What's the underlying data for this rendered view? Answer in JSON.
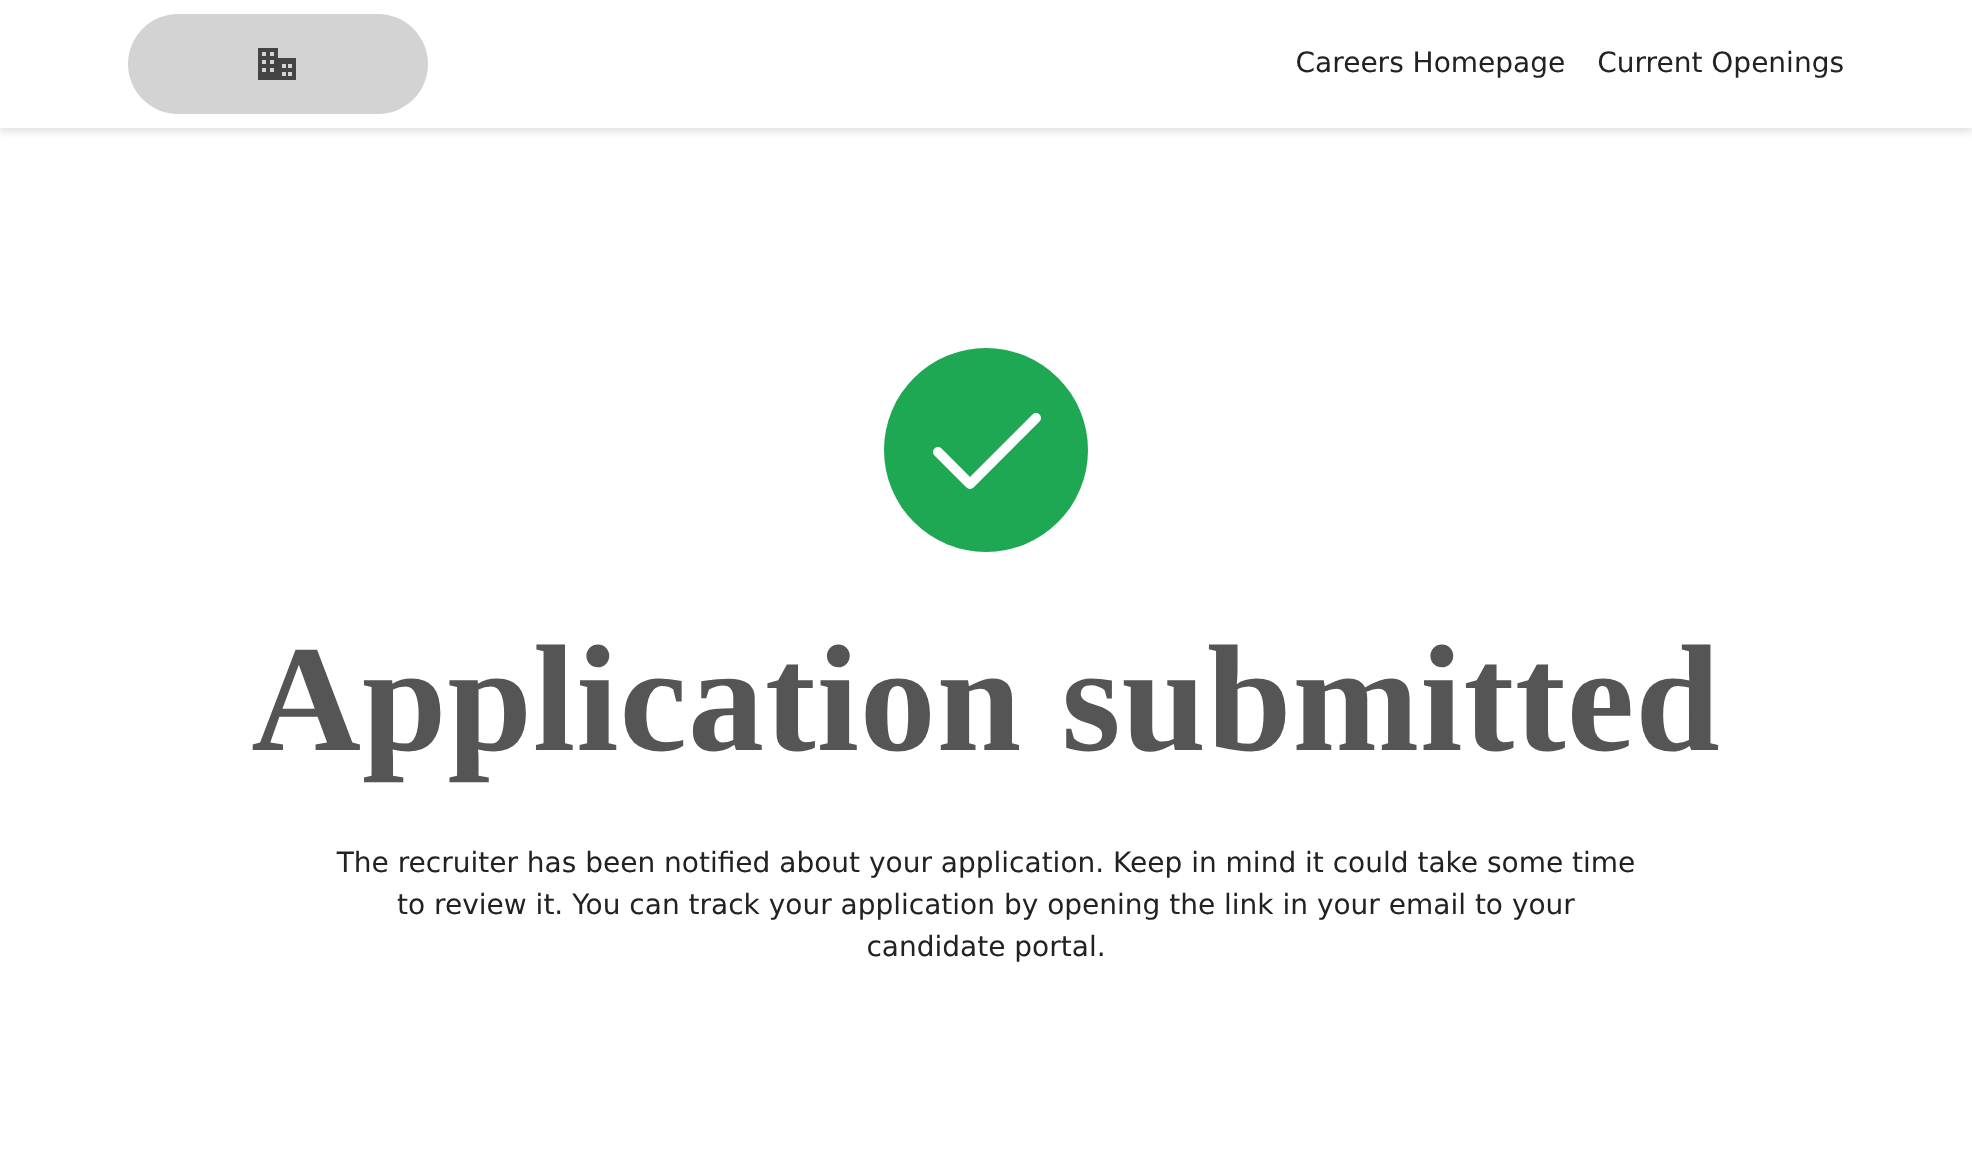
{
  "header": {
    "logo": {
      "kind": "building"
    },
    "nav_links": [
      "Careers Homepage",
      "Current Openings"
    ]
  },
  "confirmation": {
    "submitted": true,
    "title": "Application submitted",
    "message": "The recruiter has been notified about your application. Keep in mind it could take some time to review it. You can track your application by opening the link in your email to your candidate portal."
  }
}
